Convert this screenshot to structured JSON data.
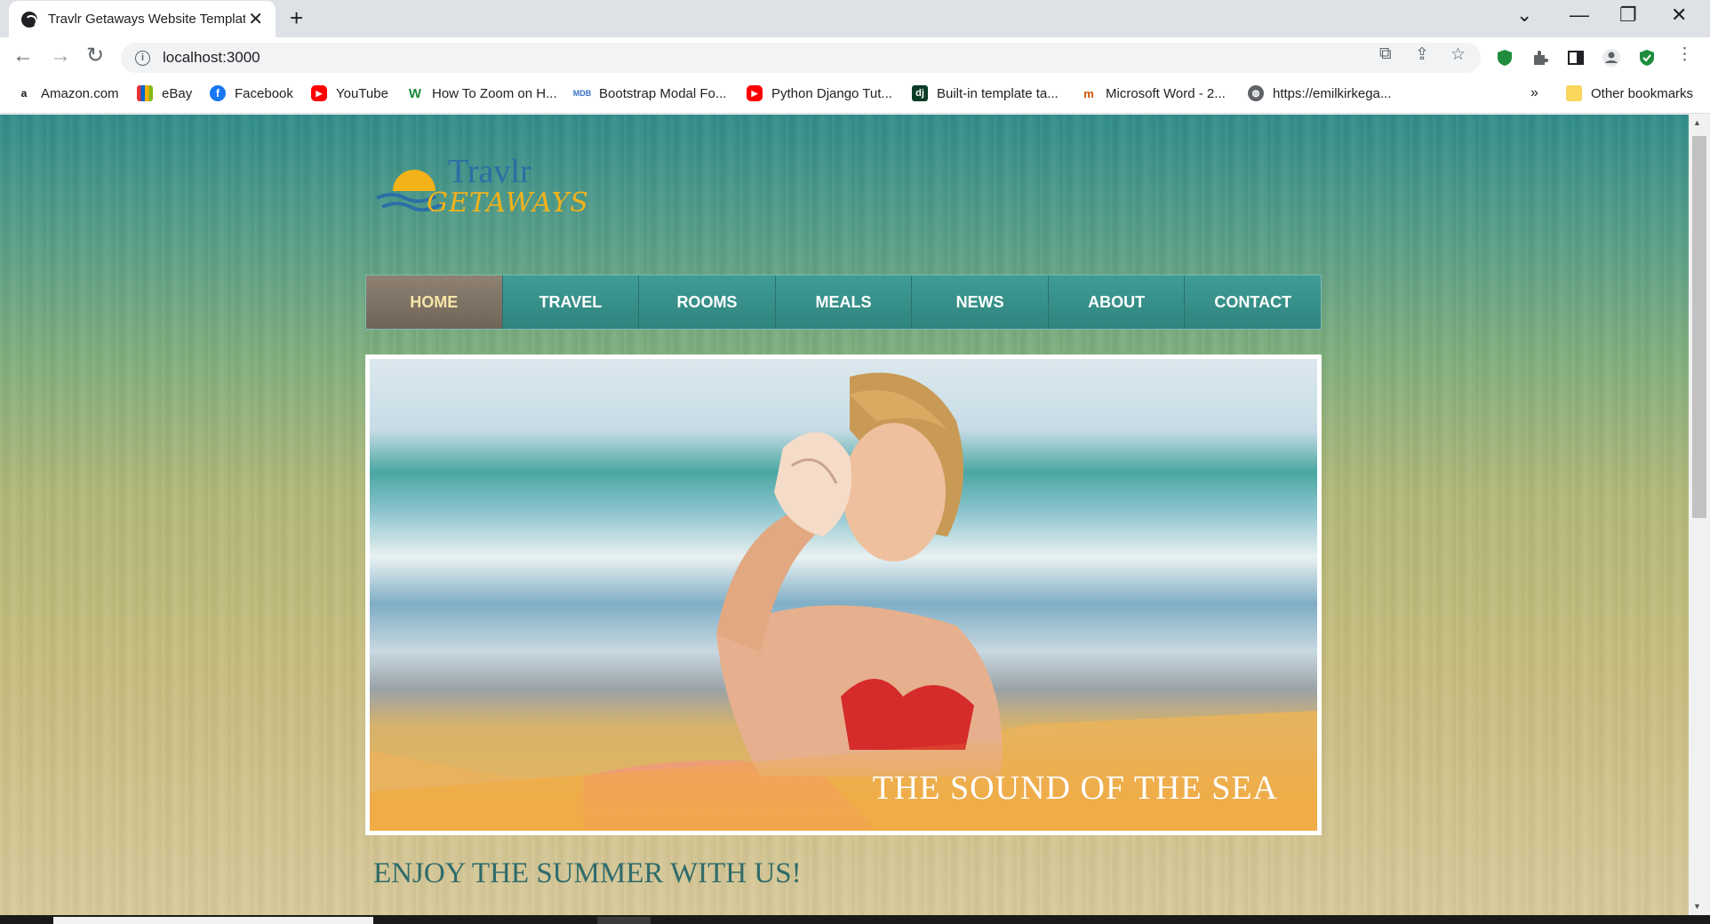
{
  "browser": {
    "tab_title": "Travlr Getaways Website Template",
    "tab_close": "✕",
    "new_tab": "+",
    "window_controls": {
      "minimize": "—",
      "restore": "❐",
      "close": "✕",
      "tabs_menu": "⌄"
    },
    "url": "localhost:3000",
    "bookmarks": [
      {
        "label": "Amazon.com",
        "icon": "amazon-icon",
        "color": "#111111"
      },
      {
        "label": "eBay",
        "icon": "ebay-icon",
        "color": "#e53238"
      },
      {
        "label": "Facebook",
        "icon": "facebook-icon",
        "color": "#1877f2"
      },
      {
        "label": "YouTube",
        "icon": "youtube-icon",
        "color": "#ff0000"
      },
      {
        "label": "How To Zoom on H...",
        "icon": "wix-icon",
        "color": "#1b8a3a"
      },
      {
        "label": "Bootstrap Modal Fo...",
        "icon": "mdb-icon",
        "color": "#3b71ca"
      },
      {
        "label": "Python Django Tut...",
        "icon": "youtube-icon",
        "color": "#ff0000"
      },
      {
        "label": "Built-in template ta...",
        "icon": "django-icon",
        "color": "#0c3c26"
      },
      {
        "label": "Microsoft Word - 2...",
        "icon": "document-icon",
        "color": "#d35400"
      },
      {
        "label": "https://emilkirkega...",
        "icon": "globe-icon",
        "color": "#5f6368"
      }
    ],
    "bookmarks_overflow": "»",
    "other_bookmarks": "Other bookmarks"
  },
  "site": {
    "logo": {
      "line1": "Travlr",
      "line2": "GETAWAYS"
    },
    "menu": [
      {
        "label": "HOME",
        "active": true
      },
      {
        "label": "TRAVEL",
        "active": false
      },
      {
        "label": "ROOMS",
        "active": false
      },
      {
        "label": "MEALS",
        "active": false
      },
      {
        "label": "NEWS",
        "active": false
      },
      {
        "label": "ABOUT",
        "active": false
      },
      {
        "label": "CONTACT",
        "active": false
      }
    ],
    "hero_caption": "THE SOUND OF THE SEA",
    "headline": "ENJOY THE SUMMER WITH US!"
  }
}
